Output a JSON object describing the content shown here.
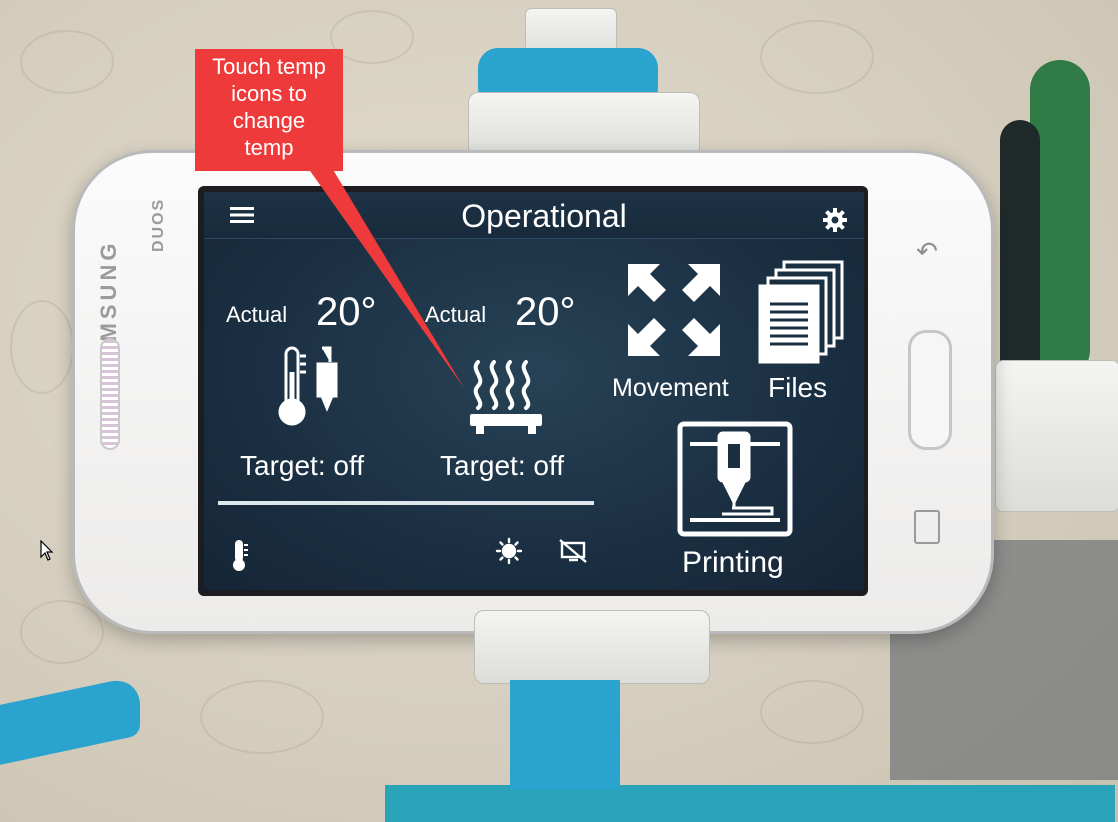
{
  "phone": {
    "brand": "SAMSUNG",
    "model_badge": "DUOS"
  },
  "app": {
    "title": "Operational",
    "hotend": {
      "actual_label": "Actual",
      "actual_value": "20°",
      "target": "Target: off"
    },
    "bed": {
      "actual_label": "Actual",
      "actual_value": "20°",
      "target": "Target: off"
    },
    "tiles": {
      "movement": "Movement",
      "files": "Files",
      "printing": "Printing"
    }
  },
  "annotation": {
    "callout_text": [
      "Touch temp",
      "icons to",
      "change",
      "temp"
    ]
  }
}
